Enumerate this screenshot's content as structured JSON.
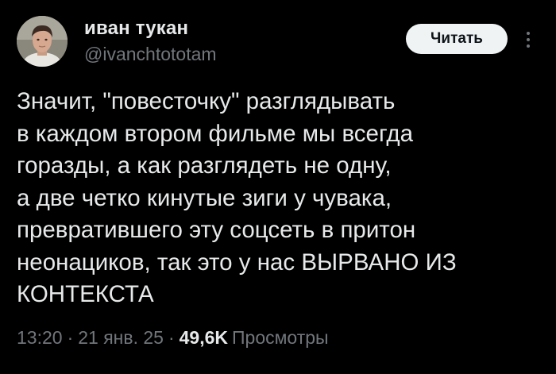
{
  "author": {
    "display_name": "иван тукан",
    "handle": "@ivanchtototam"
  },
  "follow_button": {
    "label": "Читать"
  },
  "tweet": {
    "text": "Значит, \"повесточку\" разглядывать\nв каждом втором фильме мы всегда\nгоразды, а как разглядеть не одну,\nа две четко кинутые зиги у чувака,\nпревратившего эту соцсеть в притон\nнеонациков, так это у нас ВЫРВАНО ИЗ\nКОНТЕКСТА"
  },
  "meta": {
    "time": "13:20",
    "separator": "·",
    "date": "21 янв. 25",
    "views_count": "49,6K",
    "views_label": "Просмотры"
  },
  "icons": {
    "more": "more-vertical-icon"
  },
  "colors": {
    "background": "#000000",
    "primary_text": "#e7e9ea",
    "secondary_text": "#71767b",
    "button_bg": "#eff3f4",
    "button_text": "#0f1419"
  }
}
